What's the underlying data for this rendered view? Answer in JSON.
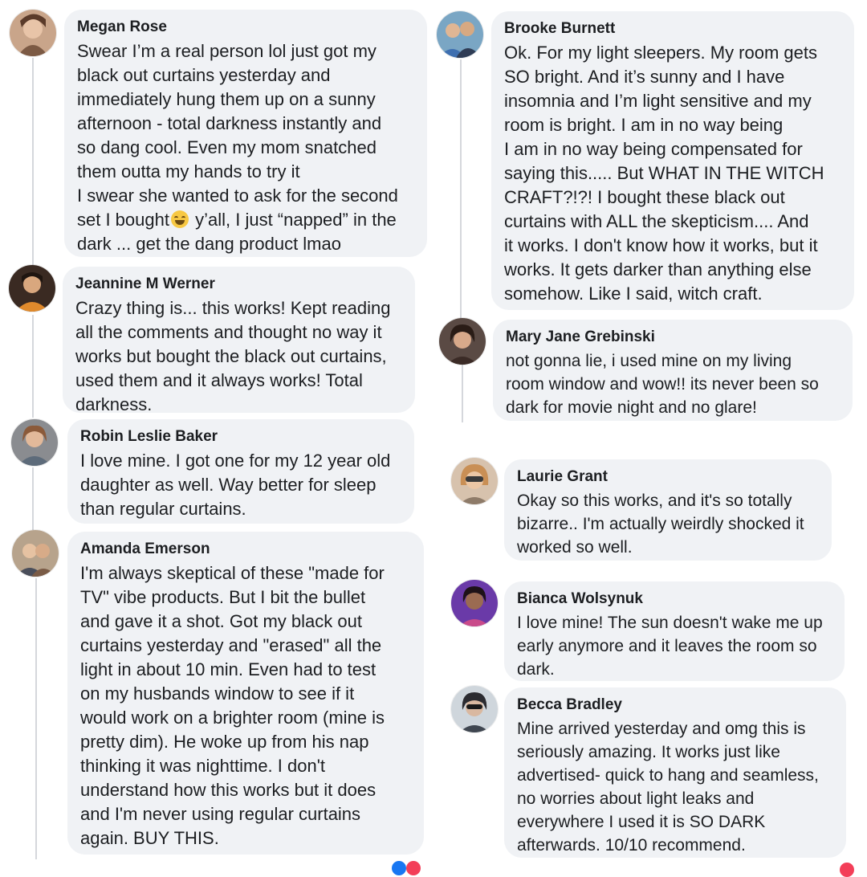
{
  "comments": {
    "megan": {
      "name": "Megan Rose",
      "line1": "Swear I’m a real person lol just got my\nblack out curtains yesterday and\nimmediately hung them up on a sunny\nafternoon - total darkness instantly and\nso dang cool. Even my mom snatched\nthem outta my hands to try it\nI swear she wanted to ask for the second\nset I bought",
      "line2": " y’all, I just “napped” in the\ndark ... get the dang product lmao",
      "emoji": "rolling-on-floor-laughing-emoji"
    },
    "jeannine": {
      "name": "Jeannine M Werner",
      "text": "Crazy thing is... this works! Kept reading\nall the comments and thought no way it\nworks but bought the black out curtains,\nused them and it always works! Total\ndarkness."
    },
    "robin": {
      "name": "Robin Leslie Baker",
      "text": "I love mine. I got one for my 12 year old\ndaughter as well. Way better for sleep\nthan regular curtains."
    },
    "amanda": {
      "name": "Amanda Emerson",
      "text": "I'm always skeptical of these \"made for\nTV\" vibe products. But I bit the bullet\nand gave it a shot. Got my black out\ncurtains yesterday and \"erased\" all the\nlight in about 10 min. Even had to test\non my husbands window to see if it\nwould work on a brighter room (mine is\npretty dim). He woke up from his nap\nthinking it was nighttime. I don't\nunderstand how this works but it does\nand I'm never using regular curtains\nagain. BUY THIS."
    },
    "brooke": {
      "name": "Brooke Burnett",
      "text": "Ok. For my light sleepers. My room gets\nSO bright. And it’s sunny and I have\ninsomnia and I’m light sensitive and my\nroom is bright. I am in no way being\nI am in no way being compensated for\nsaying this..... But WHAT IN THE WITCH\nCRAFT?!?! I bought these black out\ncurtains with ALL the skepticism.... And\nit works. I don't know how it works, but it\nworks. It gets darker than anything else\nsomehow. Like I said, witch craft."
    },
    "mary": {
      "name": "Mary Jane Grebinski",
      "text": "not gonna lie, i used mine on my living\nroom window and wow!! its never been so\ndark for movie night and no glare!"
    },
    "laurie": {
      "name": "Laurie Grant",
      "text": "Okay so this works, and it's so totally\nbizarre.. I'm actually weirdly shocked it\nworked so well."
    },
    "bianca": {
      "name": "Bianca Wolsynuk",
      "text": "I love mine! The sun doesn't wake me up\nearly anymore and it leaves the room so\ndark."
    },
    "becca": {
      "name": "Becca Bradley",
      "text": "Mine arrived yesterday and omg this is\nseriously amazing. It works just like\nadvertised- quick to hang and seamless,\nno worries about light leaks and\neverywhere I used it is SO DARK\nafterwards. 10/10 recommend."
    }
  },
  "colors": {
    "bubble": "#f0f2f5",
    "text": "#1c1e21",
    "thread_line": "#d5d7dc"
  }
}
